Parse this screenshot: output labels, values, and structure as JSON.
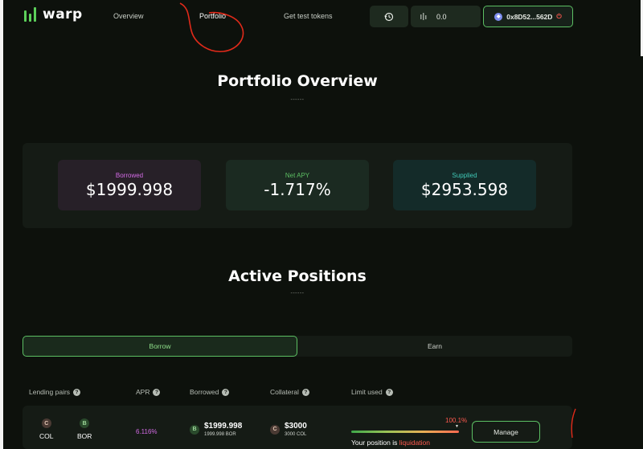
{
  "app": {
    "logo_text": "warp",
    "brand_color": "#5cd05a"
  },
  "nav": {
    "links": [
      "Overview",
      "Portfolio",
      "Get test tokens"
    ],
    "active": "Portfolio",
    "history_icon": "history-clock-icon",
    "balance_icon": "bars-icon",
    "balance_value": "0.0",
    "wallet_address": "0x8D52...562D",
    "wallet_network_icon": "ethereum-icon",
    "wallet_power_icon": "power-icon"
  },
  "portfolio": {
    "title": "Portfolio Overview",
    "divider": "------",
    "stats": [
      {
        "label": "Borrowed",
        "value": "$1999.998",
        "label_color": "#d46be6"
      },
      {
        "label": "Net APY",
        "value": "-1.717%",
        "label_color": "#5cbf63"
      },
      {
        "label": "Supplied",
        "value": "$2953.598",
        "label_color": "#3fc7b5"
      }
    ]
  },
  "positions": {
    "title": "Active Positions",
    "divider": "------",
    "tabs": [
      "Borrow",
      "Earn"
    ],
    "active_tab": "Borrow",
    "columns": [
      "Lending pairs",
      "APR",
      "Borrowed",
      "Collateral",
      "Limit used"
    ],
    "rows": [
      {
        "pair": [
          {
            "badge": "C",
            "name": "COL"
          },
          {
            "badge": "B",
            "name": "BOR"
          }
        ],
        "apr": "6.116%",
        "borrowed": {
          "badge": "B",
          "amount": "$1999.998",
          "sub": "1999.998 BOR"
        },
        "collateral": {
          "badge": "C",
          "amount": "$3000",
          "sub": "3000 COL"
        },
        "limit": {
          "percent": "100.1%",
          "fill": 1.001,
          "note_prefix": "Your position is",
          "note_status": "liquidation"
        },
        "action": "Manage"
      }
    ]
  }
}
